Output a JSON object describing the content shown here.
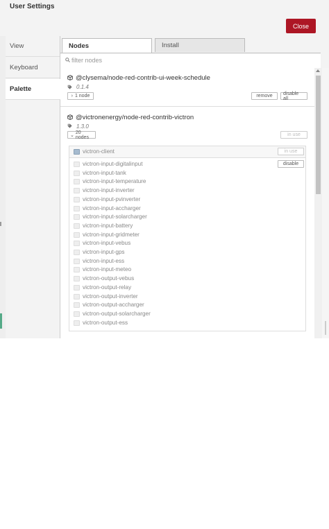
{
  "dialog": {
    "title": "User Settings",
    "close_label": "Close",
    "accent_color": "#ad1625"
  },
  "sidebar": {
    "items": [
      {
        "label": "View",
        "active": false
      },
      {
        "label": "Keyboard",
        "active": false
      },
      {
        "label": "Palette",
        "active": true
      }
    ]
  },
  "palette": {
    "tabs": [
      {
        "label": "Nodes",
        "active": true
      },
      {
        "label": "Install",
        "active": false
      }
    ],
    "filter_placeholder": "filter nodes",
    "packages": [
      {
        "name": "@clysema/node-red-contrib-ui-week-schedule",
        "version": "0.1.4",
        "toggle_label": "1 node",
        "toggle_icon": "›",
        "buttons": [
          "remove",
          "disable all"
        ]
      },
      {
        "name": "@victronenergy/node-red-contrib-victron",
        "version": "1.3.0",
        "toggle_label": "20 nodes",
        "toggle_icon": "⌄",
        "buttons": [
          "in use"
        ]
      }
    ],
    "victron_nodes": [
      {
        "label": "victron-client",
        "button": "in use"
      },
      {
        "label": "victron-input-digitalinput",
        "button": "disable"
      },
      {
        "label": "victron-input-tank"
      },
      {
        "label": "victron-input-temperature"
      },
      {
        "label": "victron-input-inverter"
      },
      {
        "label": "victron-input-pvinverter"
      },
      {
        "label": "victron-input-accharger"
      },
      {
        "label": "victron-input-solarcharger"
      },
      {
        "label": "victron-input-battery"
      },
      {
        "label": "victron-input-gridmeter"
      },
      {
        "label": "victron-input-vebus"
      },
      {
        "label": "victron-input-gps"
      },
      {
        "label": "victron-input-ess"
      },
      {
        "label": "victron-input-meteo"
      },
      {
        "label": "victron-output-vebus"
      },
      {
        "label": "victron-output-relay"
      },
      {
        "label": "victron-output-inverter"
      },
      {
        "label": "victron-output-accharger"
      },
      {
        "label": "victron-output-solarcharger"
      },
      {
        "label": "victron-output-ess"
      }
    ]
  }
}
